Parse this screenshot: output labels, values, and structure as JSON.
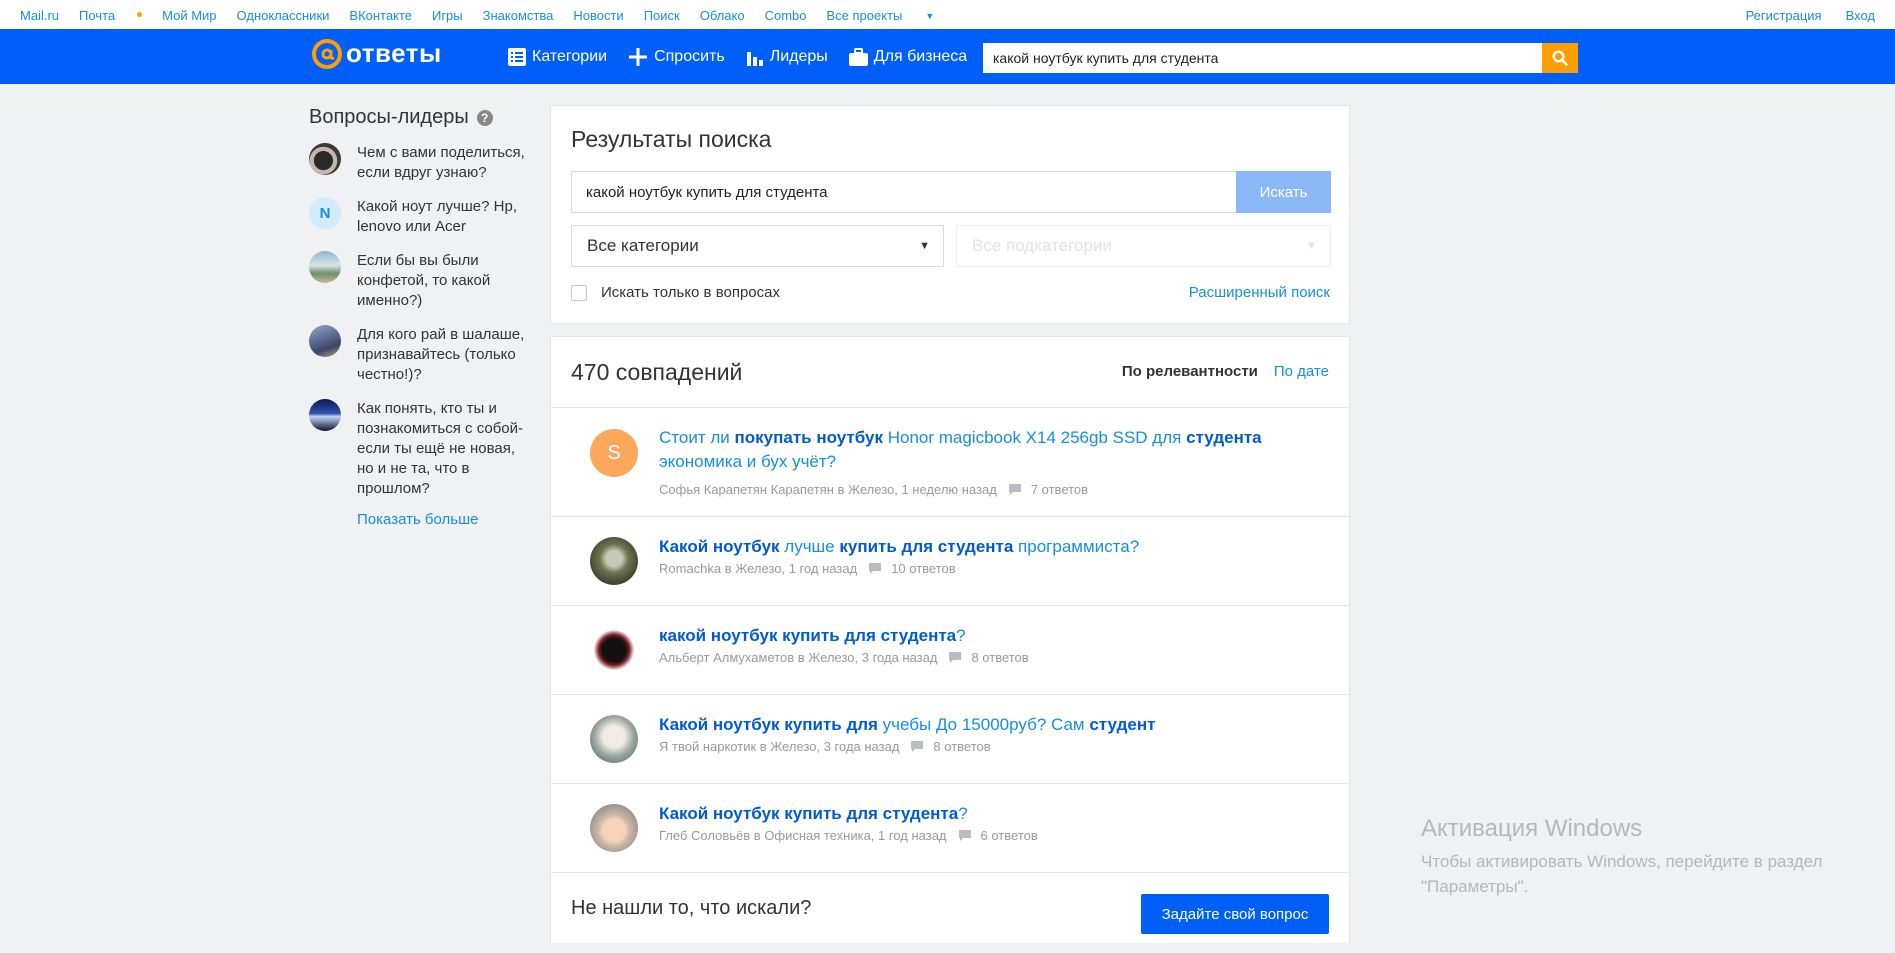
{
  "portal": {
    "links": [
      "Mail.ru",
      "Почта",
      "Мой Мир",
      "Одноклассники",
      "ВКонтакте",
      "Игры",
      "Знакомства",
      "Новости",
      "Поиск",
      "Облако",
      "Combo",
      "Все проекты"
    ],
    "right_links": [
      "Регистрация",
      "Вход"
    ]
  },
  "header": {
    "logo_text": "ответы",
    "nav": [
      "Категории",
      "Спросить",
      "Лидеры",
      "Для бизнеса"
    ],
    "search_value": "какой ноутбук купить для студента",
    "accent_color": "#005ff9",
    "brand_orange": "#ff9e00"
  },
  "sidebar": {
    "title": "Вопросы-лидеры",
    "help_mark": "?",
    "items": [
      {
        "text": "Чем с вами поделиться, если вдруг узнаю?",
        "avatar": "photo"
      },
      {
        "text": "Какой ноут лучше? Hp, lenovo или Acer",
        "avatar": "N"
      },
      {
        "text": "Если бы вы были конфетой, то какой именно?)",
        "avatar": "photo"
      },
      {
        "text": "Для кого рай в шалаше, признавайтесь (только честно!)?",
        "avatar": "photo"
      },
      {
        "text": "Как понять, кто ты и познакомиться с собой- если ты ещё не новая, но и не та, что в прошлом?",
        "avatar": "photo"
      }
    ],
    "show_more": "Показать больше"
  },
  "search": {
    "heading": "Результаты поиска",
    "query": "какой ноутбук купить для студента",
    "button": "Искать",
    "category": "Все категории",
    "subcategory": "Все подкатегории",
    "only_questions": "Искать только в вопросах",
    "advanced": "Расширенный поиск"
  },
  "results": {
    "count": "470 совпадений",
    "sort_active": "По релевантности",
    "sort_other": "По дате",
    "items": [
      {
        "parts": [
          [
            "Стоит ли ",
            false
          ],
          [
            "покупать ноутбук",
            true
          ],
          [
            " Honor magicbook X14 256gb SSD для ",
            false
          ],
          [
            "студента",
            true
          ],
          [
            " экономика и бух учёт?",
            false
          ]
        ],
        "author": "Софья Карапетян Карапетян",
        "category": "Железо",
        "time": "1 неделю назад",
        "answers": "7 ответов",
        "avatar_letter": "S"
      },
      {
        "parts": [
          [
            "Какой ноутбук",
            true
          ],
          [
            " лучше ",
            false
          ],
          [
            "купить для студента",
            true
          ],
          [
            " программиста?",
            false
          ]
        ],
        "author": "Romachka",
        "category": "Железо",
        "time": "1 год назад",
        "answers": "10 ответов",
        "avatar_letter": ""
      },
      {
        "parts": [
          [
            "какой ноутбук купить для студента",
            true
          ],
          [
            "?",
            false
          ]
        ],
        "author": "Альберт Алмухаметов",
        "category": "Железо",
        "time": "3 года назад",
        "answers": "8 ответов",
        "avatar_letter": ""
      },
      {
        "parts": [
          [
            "Какой ноутбук купить для",
            true
          ],
          [
            " учебы До 15000руб? Сам ",
            false
          ],
          [
            "студент",
            true
          ]
        ],
        "author": "Я твой наркотик",
        "category": "Железо",
        "time": "3 года назад",
        "answers": "8 ответов",
        "avatar_letter": ""
      },
      {
        "parts": [
          [
            "Какой ноутбук купить для студента",
            true
          ],
          [
            "?",
            false
          ]
        ],
        "author": "Глеб Соловьёв",
        "category": "Офисная техника",
        "time": "1 год назад",
        "answers": "6 ответов",
        "avatar_letter": ""
      }
    ],
    "in_word": "в",
    "not_found": "Не нашли то, что искали?",
    "ask_button": "Задайте свой вопрос"
  },
  "watermark": {
    "title": "Активация Windows",
    "line1": "Чтобы активировать Windows, перейдите в раздел",
    "line2": "\"Параметры\"."
  }
}
